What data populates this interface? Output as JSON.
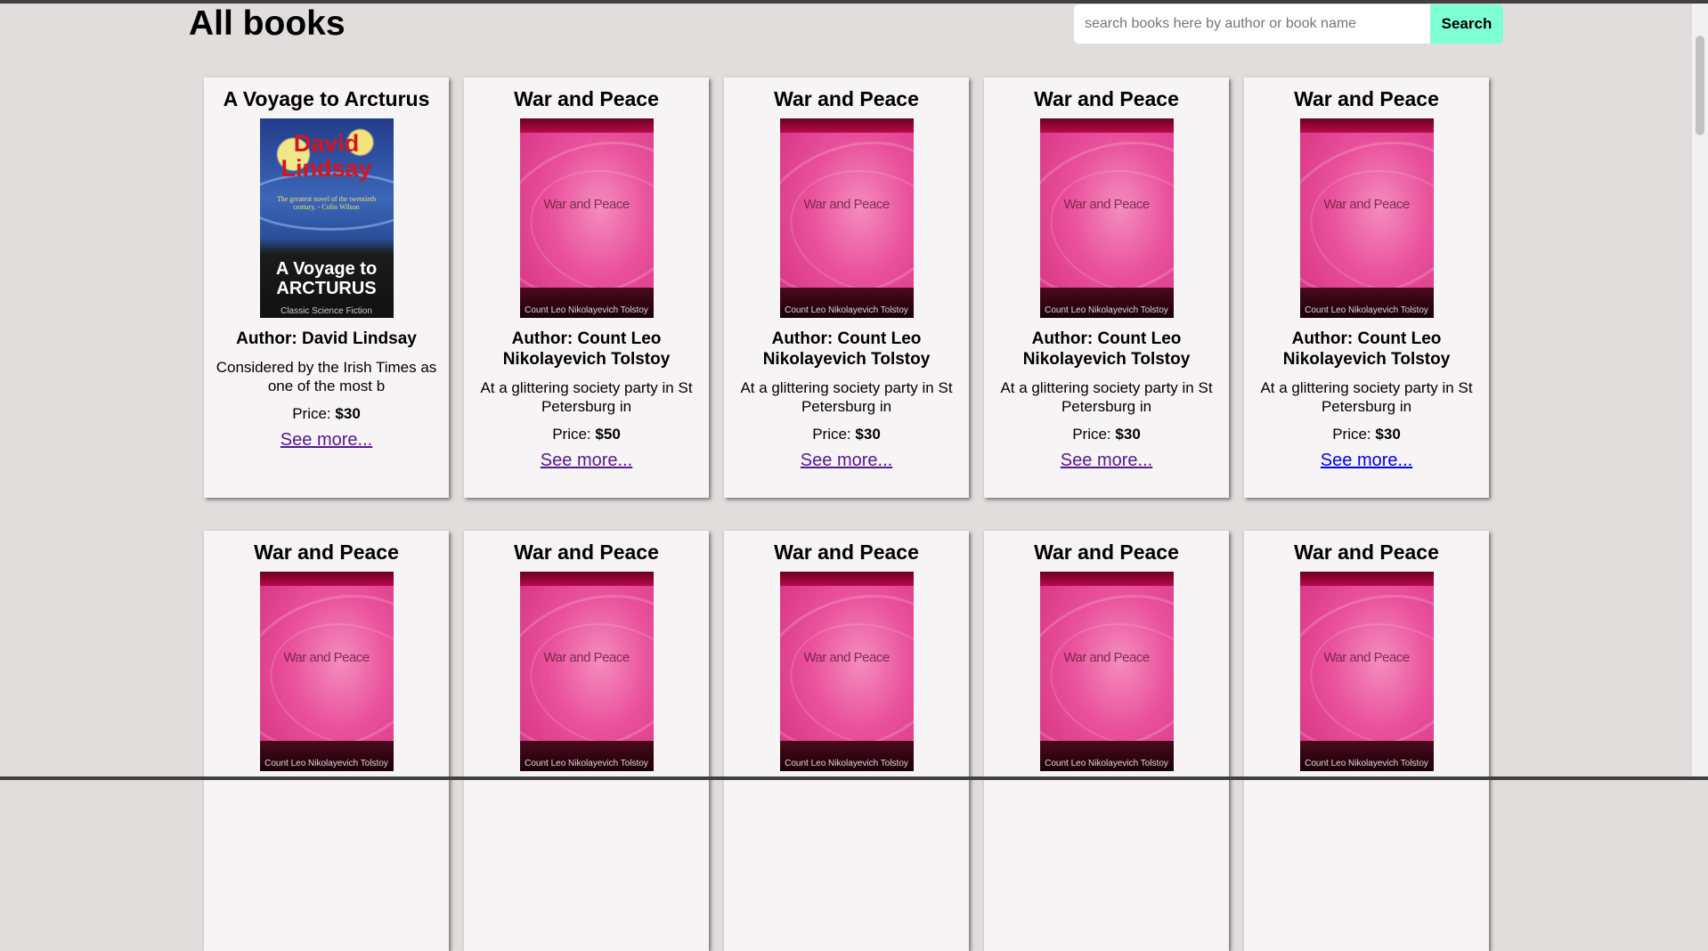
{
  "header": {
    "title": "All books",
    "search_placeholder": "search books here by author or book name",
    "search_button": "Search"
  },
  "books": [
    {
      "title": "A Voyage to Arcturus",
      "author": "Author: David Lindsay",
      "description": "Considered by the Irish Times as one of the most b",
      "price_label": "Price:",
      "price": "$30",
      "link": "See more...",
      "cover": {
        "style": "voyage",
        "author_text": "David Lindsay",
        "tagline": "The greatest novel of the twentieth century. - Colin Wilson",
        "title_text": "A Voyage to ARCTURUS",
        "subtitle": "Classic Science Fiction"
      }
    },
    {
      "title": "War and Peace",
      "author": "Author: Count Leo Nikolayevich Tolstoy",
      "description": "At a glittering society party in St Petersburg in",
      "price_label": "Price:",
      "price": "$50",
      "link": "See more...",
      "cover": {
        "style": "war-peace",
        "title_text": "War and Peace",
        "author_text": "Count Leo Nikolayevich Tolstoy"
      }
    },
    {
      "title": "War and Peace",
      "author": "Author: Count Leo Nikolayevich Tolstoy",
      "description": "At a glittering society party in St Petersburg in",
      "price_label": "Price:",
      "price": "$30",
      "link": "See more...",
      "cover": {
        "style": "war-peace",
        "title_text": "War and Peace",
        "author_text": "Count Leo Nikolayevich Tolstoy"
      }
    },
    {
      "title": "War and Peace",
      "author": "Author: Count Leo Nikolayevich Tolstoy",
      "description": "At a glittering society party in St Petersburg in",
      "price_label": "Price:",
      "price": "$30",
      "link": "See more...",
      "cover": {
        "style": "war-peace",
        "title_text": "War and Peace",
        "author_text": "Count Leo Nikolayevich Tolstoy"
      }
    },
    {
      "title": "War and Peace",
      "author": "Author: Count Leo Nikolayevich Tolstoy",
      "description": "At a glittering society party in St Petersburg in",
      "price_label": "Price:",
      "price": "$30",
      "link": "See more...",
      "cover": {
        "style": "war-peace",
        "title_text": "War and Peace",
        "author_text": "Count Leo Nikolayevich Tolstoy"
      }
    },
    {
      "title": "War and Peace",
      "cover": {
        "style": "war-peace",
        "title_text": "War and Peace",
        "author_text": "Count Leo Nikolayevich Tolstoy"
      }
    },
    {
      "title": "War and Peace",
      "cover": {
        "style": "war-peace",
        "title_text": "War and Peace",
        "author_text": "Count Leo Nikolayevich Tolstoy"
      }
    },
    {
      "title": "War and Peace",
      "cover": {
        "style": "war-peace",
        "title_text": "War and Peace",
        "author_text": "Count Leo Nikolayevich Tolstoy"
      }
    },
    {
      "title": "War and Peace",
      "cover": {
        "style": "war-peace",
        "title_text": "War and Peace",
        "author_text": "Count Leo Nikolayevich Tolstoy"
      }
    },
    {
      "title": "War and Peace",
      "cover": {
        "style": "war-peace",
        "title_text": "War and Peace",
        "author_text": "Count Leo Nikolayevich Tolstoy"
      }
    }
  ],
  "colors": {
    "background": "#e0dddc",
    "card": "#f6f4f4",
    "search_button": "#7fffd4",
    "link_visited": "#551a8b",
    "link_unvisited": "#0000ee"
  }
}
